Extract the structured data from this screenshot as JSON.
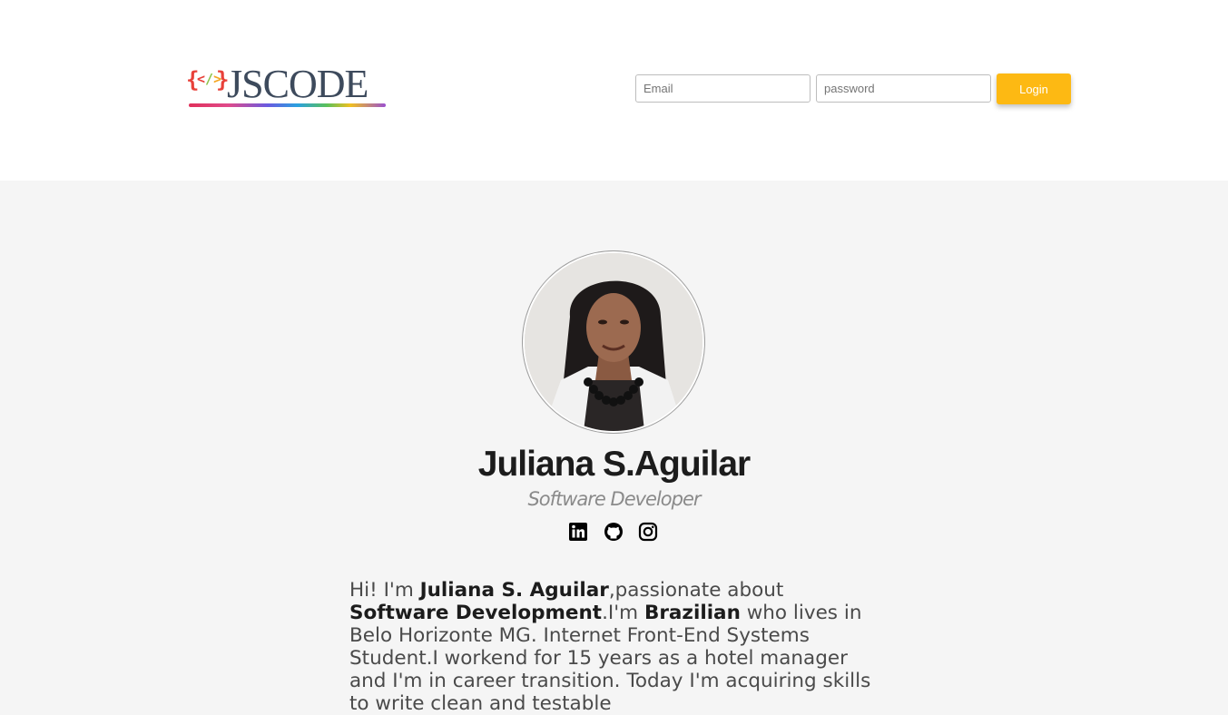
{
  "header": {
    "logo": {
      "word": "JSCODE",
      "tag_open": "{",
      "tag_lt": "<",
      "tag_slash": "/",
      "tag_gt": ">",
      "tag_close": "}"
    },
    "email_placeholder": "Email",
    "password_placeholder": "password",
    "login_label": "Login"
  },
  "profile": {
    "name": "Juliana S.Aguilar",
    "role": "Software Developer",
    "socials": [
      "linkedin-icon",
      "github-icon",
      "instagram-icon"
    ]
  },
  "bio": {
    "p1": "Hi! I'm ",
    "b1": "Juliana S. Aguilar",
    "p2": ",passionate about ",
    "b2": "Software Development",
    "p3": ".I'm ",
    "b3": "Brazilian",
    "p4": " who lives in Belo Horizonte MG. Internet Front-End Systems Student.I workend for 15 years as a hotel manager and I'm in career transition. Today I'm acquiring skills to write clean and testable"
  },
  "colors": {
    "accent": "#fdb913",
    "header_bg": "#ffffff",
    "page_bg": "#f5f5f5"
  }
}
